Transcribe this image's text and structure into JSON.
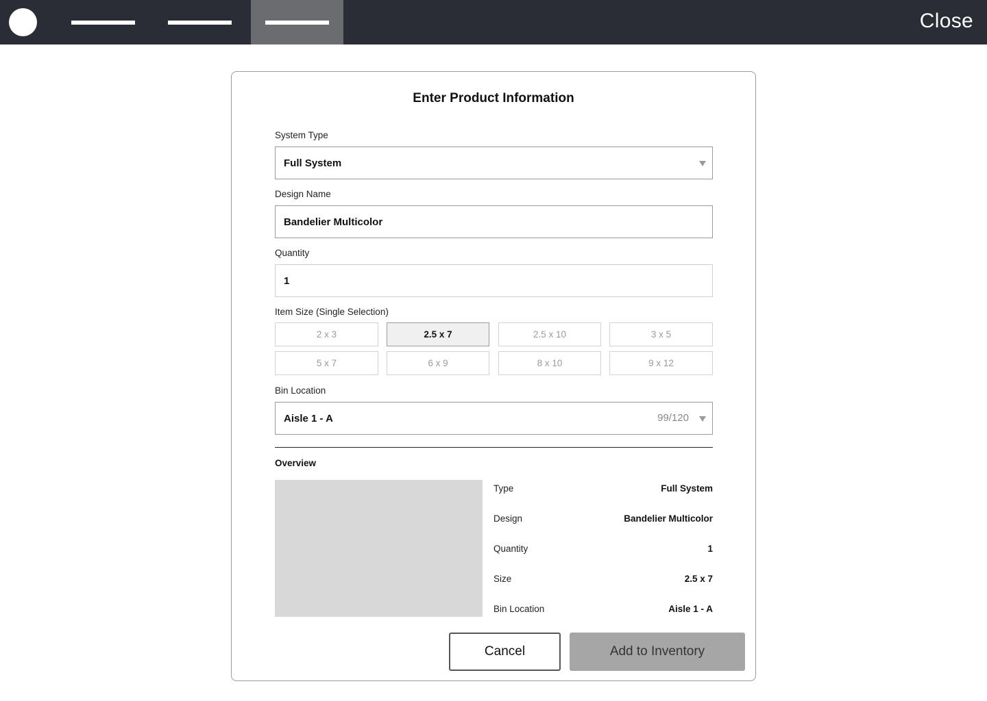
{
  "header": {
    "close_label": "Close"
  },
  "modal": {
    "title": "Enter Product Information",
    "system_type": {
      "label": "System Type",
      "value": "Full System"
    },
    "design_name": {
      "label": "Design Name",
      "value": "Bandelier Multicolor"
    },
    "quantity": {
      "label": "Quantity",
      "value": "1"
    },
    "item_size": {
      "label": "Item Size (Single Selection)",
      "options": [
        "2 x 3",
        "2.5 x 7",
        "2.5 x 10",
        "3 x 5",
        "5 x 7",
        "6 x 9",
        "8 x 10",
        "9 x 12"
      ],
      "selected": "2.5 x 7"
    },
    "bin_location": {
      "label": "Bin Location",
      "value": "Aisle 1 - A",
      "count": "99/120"
    },
    "overview": {
      "title": "Overview",
      "rows": [
        {
          "key": "Type",
          "value": "Full System"
        },
        {
          "key": "Design",
          "value": "Bandelier Multicolor"
        },
        {
          "key": "Quantity",
          "value": "1"
        },
        {
          "key": "Size",
          "value": "2.5 x 7"
        },
        {
          "key": "Bin Location",
          "value": "Aisle 1 - A"
        }
      ]
    },
    "buttons": {
      "cancel": "Cancel",
      "add": "Add to Inventory"
    }
  }
}
